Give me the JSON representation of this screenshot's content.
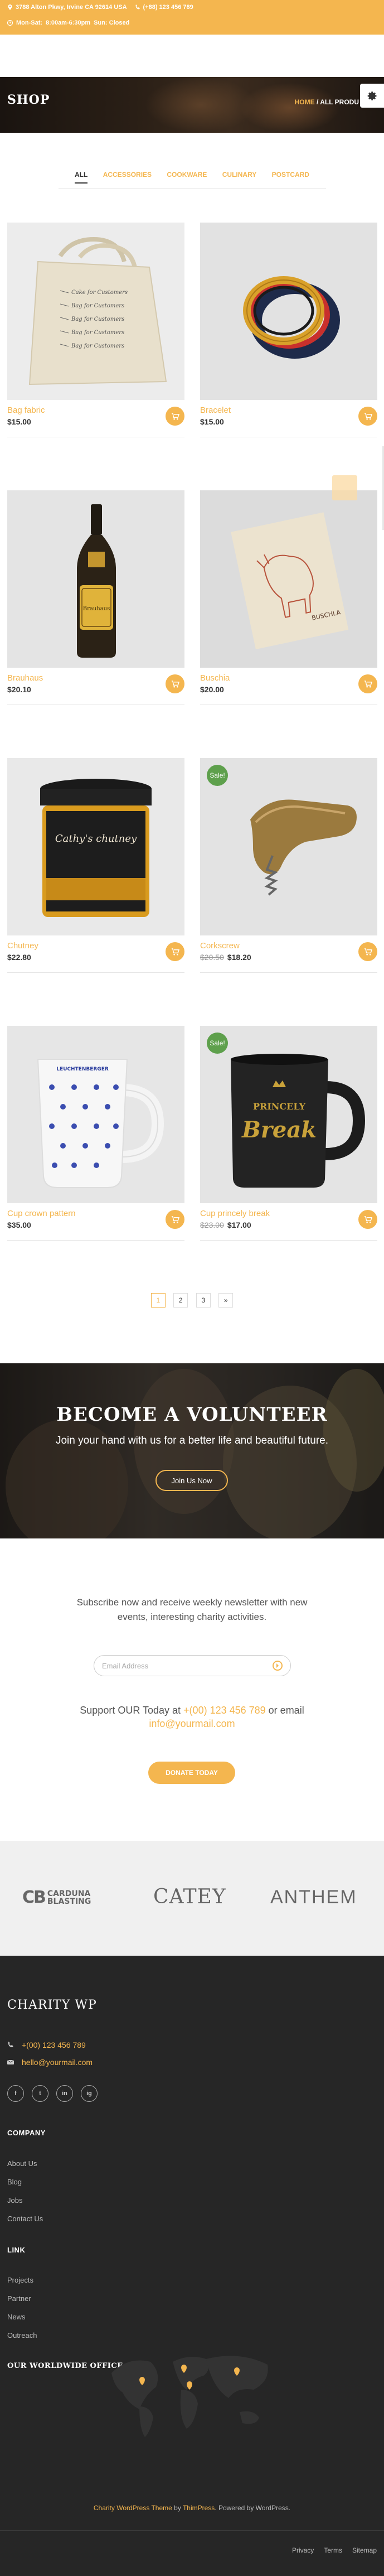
{
  "topbar": {
    "address": "3788 Alton Pkwy, Irvine CA 92614 USA",
    "phone": "(+88) 123 456 789",
    "hours_label": "Mon-Sat:",
    "hours_value": "8:00am-6:30pm",
    "sunday": "Sun: Closed"
  },
  "hero": {
    "title": "SHOP",
    "crumb_home": "HOME",
    "crumb_sep": "/",
    "crumb_current": "ALL PRODU"
  },
  "tabs": [
    "ALL",
    "ACCESSORIES",
    "COOKWARE",
    "CULINARY",
    "POSTCARD"
  ],
  "products": [
    {
      "name": "Bag fabric",
      "price": "$15.00",
      "old_price": "",
      "sale": ""
    },
    {
      "name": "Bracelet",
      "price": "$15.00",
      "old_price": "",
      "sale": ""
    },
    {
      "name": "Brauhaus",
      "price": "$20.10",
      "old_price": "",
      "sale": ""
    },
    {
      "name": "Buschia",
      "price": "$20.00",
      "old_price": "",
      "sale": ""
    },
    {
      "name": "Chutney",
      "price": "$22.80",
      "old_price": "",
      "sale": ""
    },
    {
      "name": "Corkscrew",
      "price": "$18.20",
      "old_price": "$20.50",
      "sale": "Sale!"
    },
    {
      "name": "Cup crown pattern",
      "price": "$35.00",
      "old_price": "",
      "sale": ""
    },
    {
      "name": "Cup princely break",
      "price": "$17.00",
      "old_price": "$23.00",
      "sale": "Sale!"
    }
  ],
  "product_art": {
    "bag_lines": [
      "Cake for Customers",
      "Bag for Customers",
      "Bag for Customers",
      "Bag for Customers",
      "Bag for Customers"
    ],
    "beer_label": "Brauhaus",
    "card_text": "BUSCHLA",
    "jar_brand": "Cathy's chutney",
    "mug_brand": "LEUCHTENBERGER",
    "mug2_text_top": "PRINCELY",
    "mug2_text_bottom": "Break"
  },
  "pager": [
    "1",
    "2",
    "3",
    "»"
  ],
  "volunteer": {
    "title": "BECOME A VOLUNTEER",
    "text": "Join your hand with us for a better life and beautiful future.",
    "button": "Join Us Now"
  },
  "subscribe": {
    "line1": "Subscribe now and receive weekly newsletter with new",
    "line2": "events, interesting charity activities.",
    "placeholder": "Email Address"
  },
  "support": {
    "prefix": "Support OUR Today at ",
    "phone": "+(00) 123 456 789",
    "middle": " or email",
    "email": "info@yourmail.com",
    "button": "DONATE TODAY"
  },
  "logos": {
    "cb_mark": "CB",
    "cb_line1": "CARDUNA",
    "cb_line2": "BLASTING",
    "catey": "CATEY",
    "anthem": "ANTHEM"
  },
  "footer": {
    "brand": "CHARITY WP",
    "phone": "+(00) 123 456 789",
    "email": "hello@yourmail.com",
    "social": [
      "f",
      "t",
      "in",
      "ig"
    ],
    "company_title": "COMPANY",
    "company_links": [
      "About Us",
      "Blog",
      "Jobs",
      "Contact Us"
    ],
    "link_title": "LINK",
    "link_links": [
      "Projects",
      "Partner",
      "News",
      "Outreach"
    ],
    "office_title": "OUR WORLDWIDE OFFICE",
    "credit_theme": "Charity WordPress Theme",
    "credit_by": " by ",
    "credit_author": "ThimPress",
    "credit_tail": ". Powered by WordPress.",
    "bottom_links": [
      "Privacy",
      "Terms",
      "Sitemap"
    ]
  },
  "colors": {
    "accent": "#f4b64f",
    "footer_bg": "#262626",
    "sale_badge": "#5ea04c"
  }
}
